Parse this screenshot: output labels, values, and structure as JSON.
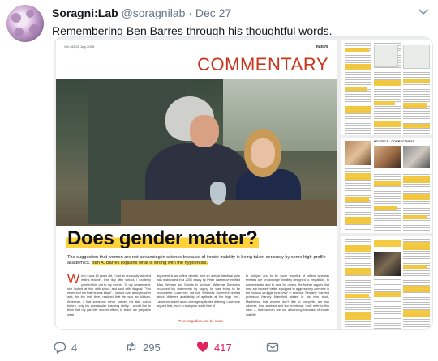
{
  "tweet": {
    "display_name": "Soragni:Lab",
    "handle": "@soragnilab",
    "separator": "·",
    "date": "Dec 27",
    "text": "Remembering Ben Barres through his thoughtful words.",
    "avatar_icon": "lab-logo-avatar"
  },
  "article": {
    "page_header_left": "Vol 442|26 July 2006",
    "page_header_right": "nature",
    "section": "COMMENTARY",
    "headline": "Does gender matter",
    "headline_mark": "?",
    "deck_plain": "The suggestion that women are not advancing in science because of innate inability is being taken seriously by some high-profile academics.",
    "deck_highlight": "Ben A. Barres explains what is wrong with the hypothesis.",
    "dropcap": "W",
    "col1": "hen I was 14 years old, I had an unusually talented maths teacher. One day after school, I excitedly pointed him out to my mother. To my amazement, she looked at him with shock and said with disgust: \"You never told me that he was black\". I looked over at my teacher and, for the first time, realized that he was an African-American. I had somehow never noticed his skin colour before, only his spectacular teaching ability. I would like to think that my parents' sincere efforts to teach me prejudice were",
    "col2": "argument is an online debate, and an almost identical view was elaborated in a 2006 essay by Peter Lawrence entitled 'Men, Women and Ghosts in Science'. Whereas Summers proposed his statements by saying he was trying to be provocative, Lawrence did not. Whereas Summers replied about 'different availability of aptitude at the high end', Lawrence talked about average aptitudes differing. Lawrence argued that, even in a utopian world free of",
    "col3": "to analyse and to be more forgetful of others whereas females are 'on average' innately designed to empathize, to communicate and to care for others. He further argues that men are innately better equipped to aggressively compete in the 'vicious struggle to survive' in science. Similarly, Harvard professor Harvey Mansfield states in his new book, Manliness, that women don't like to compete, are risk adverse, less abstract and too emotional. I will refer to this view — that women are not advancing because of innate inability",
    "pullquote": "\"Few tragedies can be more"
  },
  "thumbnails": {
    "title_page2": "POLITICAL CORRECTNESS"
  },
  "actions": {
    "reply_count": "4",
    "retweet_count": "295",
    "like_count": "417"
  },
  "colors": {
    "accent_red": "#c8361d",
    "highlight_yellow": "#ffd23a",
    "like_red": "#e0245e",
    "muted_gray": "#657786"
  }
}
